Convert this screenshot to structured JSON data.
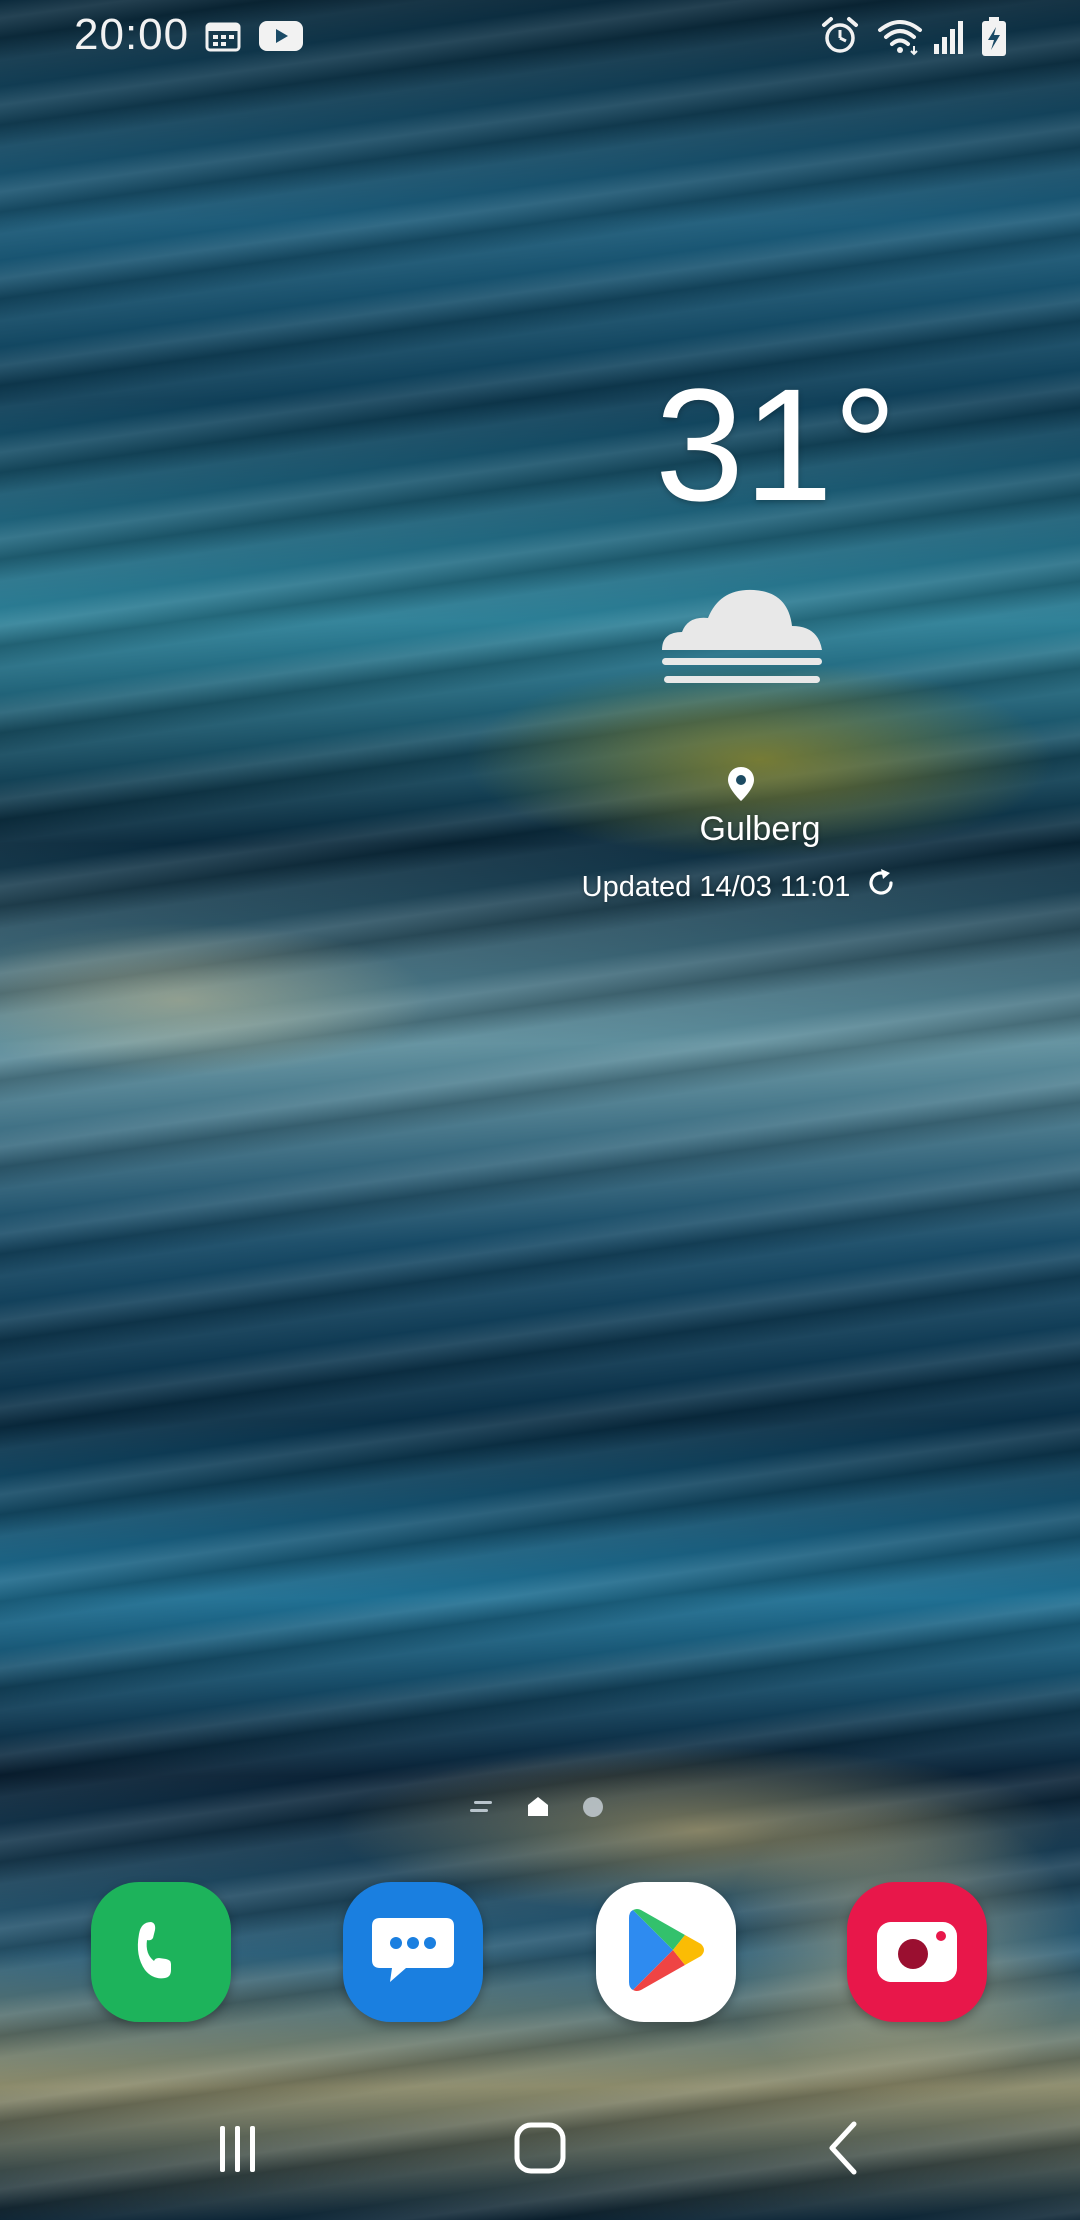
{
  "status_bar": {
    "time": "20:00",
    "left_icons": [
      "calendar-icon",
      "youtube-icon"
    ],
    "right_icons": [
      "alarm-icon",
      "wifi-icon",
      "signal-icon",
      "battery-charging-icon"
    ]
  },
  "weather_widget": {
    "temperature": "31°",
    "condition_icon": "fog-icon",
    "location_icon": "location-pin-icon",
    "location": "Gulberg",
    "updated": "Updated 14/03 11:01",
    "refresh_icon": "refresh-icon"
  },
  "page_indicator": {
    "pages": [
      "menu-page-icon",
      "home-page-icon",
      "page-dot"
    ],
    "current": "home-page-icon"
  },
  "dock": {
    "apps": [
      {
        "name": "Phone",
        "icon": "phone-icon",
        "color": "#1db35b"
      },
      {
        "name": "Messages",
        "icon": "messages-icon",
        "color": "#1a7fe0"
      },
      {
        "name": "Play Store",
        "icon": "play-store-icon",
        "color": "#ffffff"
      },
      {
        "name": "Camera",
        "icon": "camera-icon",
        "color": "#e8174a"
      }
    ]
  },
  "nav_bar": {
    "buttons": [
      "recents-icon",
      "home-icon",
      "back-icon"
    ]
  }
}
